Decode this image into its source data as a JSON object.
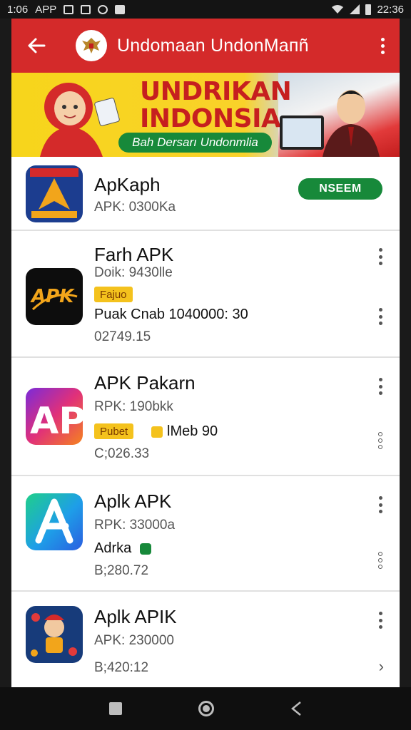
{
  "status_bar": {
    "time_left": "1:06",
    "label_left": "APP",
    "time_right": "22:36"
  },
  "app_bar": {
    "title": "Undomaan UndonMaпñ"
  },
  "banner": {
    "title_line1": "UNDRIKAN",
    "title_line2": "INDONSIA",
    "subtitle": "Bah Dersarı Undonmlia"
  },
  "apps": [
    {
      "name": "ApKaph",
      "meta": "APK: 0300Ka",
      "action": "NSEEM",
      "colors": {
        "icon": "#1c3d8f"
      }
    },
    {
      "name": "Farh APK",
      "meta": "Doik: 9430lle",
      "tag": "Fajuo",
      "detail": "Puak Cnab 1040000: 30",
      "date": "02749.15",
      "icon_text": "APK"
    },
    {
      "name": "APK Pakarn",
      "meta": "RPK: 190bkk",
      "tag": "Pubet",
      "extra": "lMeb 90",
      "date": "C;026.33",
      "icon_text": "AP"
    },
    {
      "name": "Aplk APK",
      "meta": "RPK: 33000a",
      "label": "Adrka",
      "date": "B;280.72"
    },
    {
      "name": "Aplk APIK",
      "meta": "APK: 230000",
      "date": "B;420:12"
    }
  ],
  "colors": {
    "red": "#d42a2a",
    "green": "#17893a",
    "tag_yellow": "#f4c21d",
    "banner_yellow": "#f7d51b"
  }
}
